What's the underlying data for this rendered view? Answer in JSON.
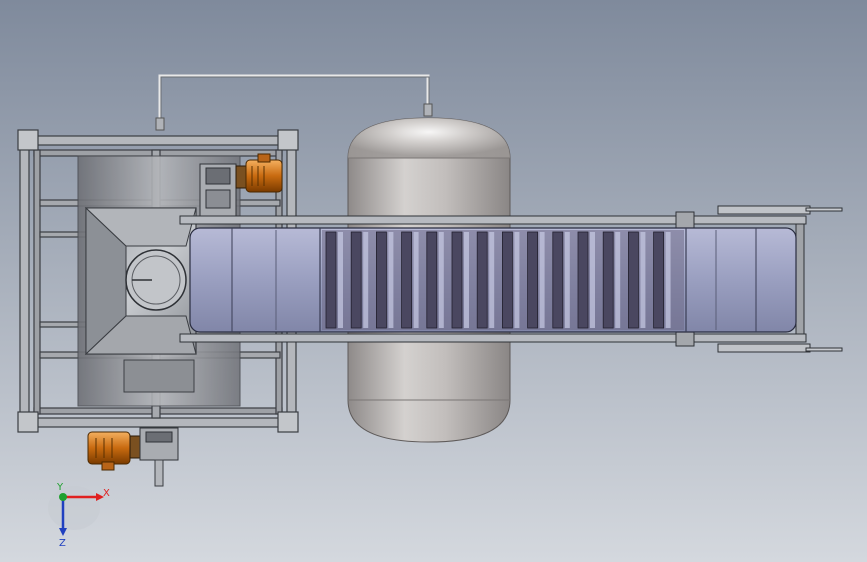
{
  "viewport": {
    "background_top": "#7f8a9c",
    "background_bottom": "#d4d8de"
  },
  "triad": {
    "x_label": "X",
    "y_label": "Y",
    "z_label": "Z",
    "x_color": "#e02020",
    "y_color": "#20a030",
    "z_color": "#2040c0"
  },
  "colors": {
    "frame": "#8a8e94",
    "tank": "#b9b5b3",
    "belt": "#9a9fc0",
    "slats": "#4a4760",
    "motor": "#d07a18"
  }
}
